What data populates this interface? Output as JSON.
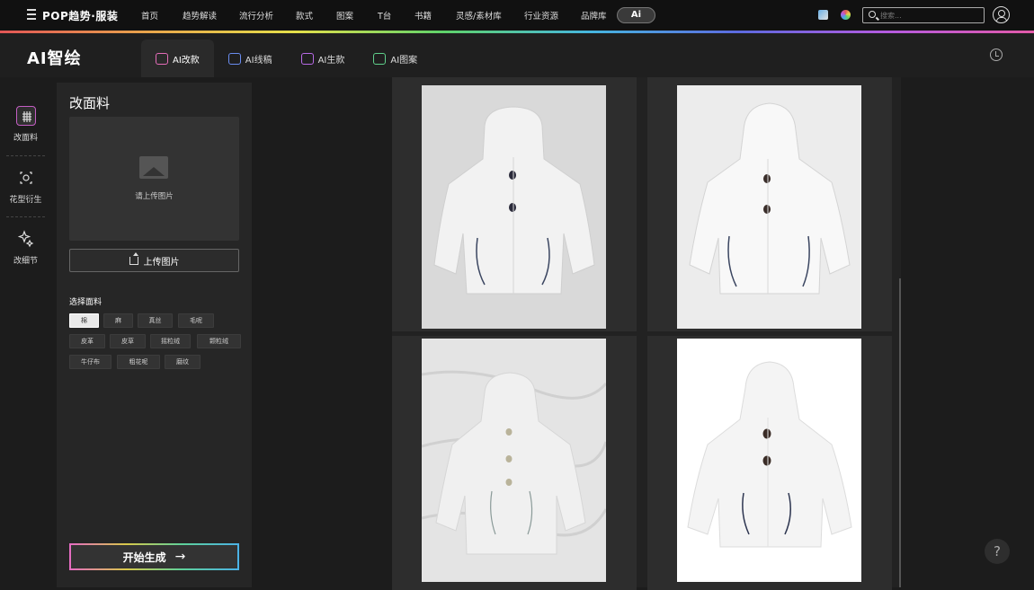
{
  "topnav": {
    "logo": "POP趋势·服装",
    "links": [
      "首页",
      "趋势解读",
      "流行分析",
      "款式",
      "图案",
      "T台",
      "书籍",
      "灵感/素材库",
      "行业资源",
      "品牌库"
    ],
    "ai_pill": "Ai",
    "search_placeholder": "搜索..."
  },
  "subheader": {
    "title": "AI智绘",
    "tabs": [
      {
        "label": "AI改款",
        "active": true
      },
      {
        "label": "AI线稿",
        "active": false
      },
      {
        "label": "AI生款",
        "active": false
      },
      {
        "label": "AI图案",
        "active": false
      }
    ]
  },
  "rail": {
    "items": [
      {
        "label": "改面料",
        "icon": "fabric-grid-icon",
        "active": true
      },
      {
        "label": "花型衍生",
        "icon": "pattern-icon",
        "active": false
      },
      {
        "label": "改细节",
        "icon": "sparkle-edit-icon",
        "active": false
      }
    ]
  },
  "panel": {
    "title": "改面料",
    "upload_hint": "请上传图片",
    "upload_button": "上传图片",
    "fabric_label": "选择面料",
    "fabrics": [
      "棉",
      "麻",
      "真丝",
      "毛呢",
      "皮革",
      "皮草",
      "摇粒绒",
      "颗粒绒",
      "牛仔布",
      "粗花呢",
      "磨纹"
    ],
    "selected_fabric": "棉",
    "generate_button": "开始生成",
    "generate_arrow": "→"
  },
  "gallery": {
    "images": [
      {
        "alt": "white-hooded-jacket-result-1"
      },
      {
        "alt": "white-hooded-jacket-result-2"
      },
      {
        "alt": "white-hooded-jacket-result-3"
      },
      {
        "alt": "white-hooded-jacket-result-4"
      }
    ]
  },
  "help": "?",
  "colors": {
    "background": "#1c1c1c",
    "panel": "#262626",
    "accent_pink": "#c45ec4"
  }
}
